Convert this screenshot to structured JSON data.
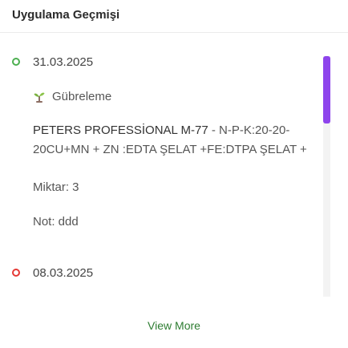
{
  "header": {
    "title": "Uygulama Geçmişi"
  },
  "entries": [
    {
      "date": "31.03.2025",
      "activity": "Gübreleme",
      "product_name": "PETERS PROFESSİONAL M-77",
      "product_detail": " - N-P-K:20-20-20CU+MN + ZN :EDTA ŞELAT +FE:DTPA ŞELAT +",
      "quantity": "Miktar: 3",
      "note": "Not: ddd",
      "status_color": "#4caf50"
    },
    {
      "date": "08.03.2025",
      "status_color": "#e53935"
    }
  ],
  "scrollbar": {
    "thumb_color": "#8e44ec"
  },
  "footer": {
    "view_more_label": "View More"
  }
}
